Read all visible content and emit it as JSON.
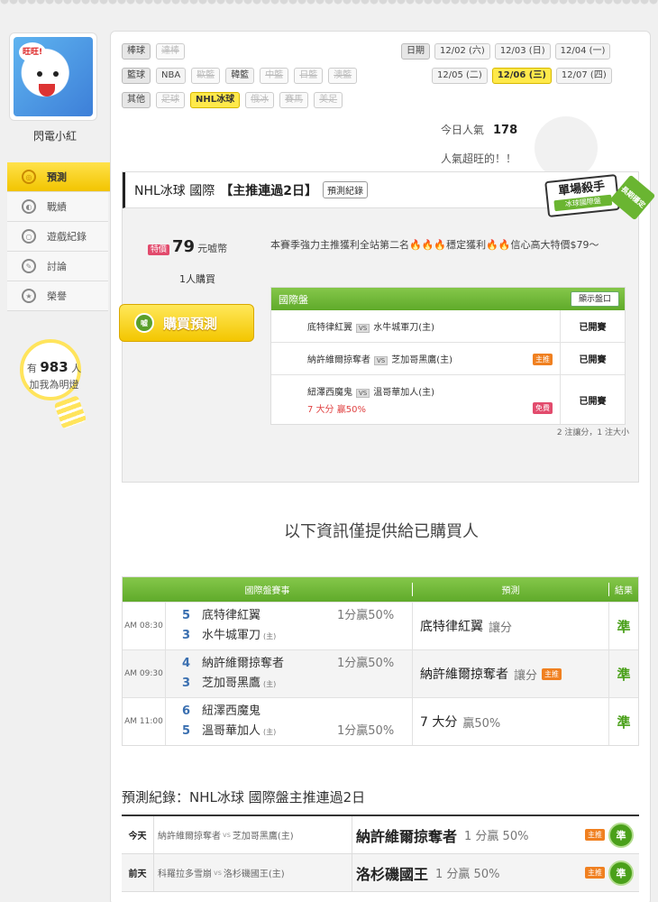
{
  "user": {
    "name": "閃電小紅",
    "avatar_bubble": "旺旺!"
  },
  "menu": [
    {
      "label": "預測",
      "icon": "target-icon",
      "active": true
    },
    {
      "label": "戰績",
      "icon": "chart-icon",
      "active": false
    },
    {
      "label": "遊戲紀錄",
      "icon": "record-icon",
      "active": false
    },
    {
      "label": "討論",
      "icon": "chat-icon",
      "active": false
    },
    {
      "label": "榮譽",
      "icon": "medal-icon",
      "active": false
    }
  ],
  "fans": {
    "prefix": "有",
    "count": "983",
    "suffix": "人",
    "cta": "加我為明燈"
  },
  "filters": {
    "baseball": {
      "label": "棒球",
      "items": [
        "達棒"
      ]
    },
    "basketball": {
      "label": "籃球",
      "items": [
        "NBA",
        "歐籃",
        "韓籃",
        "中籃",
        "日籃",
        "澳籃"
      ]
    },
    "other": {
      "label": "其他",
      "items": [
        "足球",
        "NHL冰球",
        "俄冰",
        "賽馬",
        "美足"
      ]
    }
  },
  "dates": {
    "label": "日期",
    "items": [
      "12/02 (六)",
      "12/03 (日)",
      "12/04 (一)",
      "12/05 (二)",
      "12/06 (三)",
      "12/07 (四)"
    ],
    "selected": "12/06 (三)"
  },
  "popularity": {
    "label": "今日人氣",
    "value": "178",
    "message": "人氣超旺的！！"
  },
  "product": {
    "title": "NHL冰球 國際",
    "bracket": "【主推連過2日】",
    "record_button": "預測紀錄",
    "badge_main": "單場殺手",
    "badge_sub": "冰球國際盤",
    "ribbon": "長期穩定",
    "price_tag": "特價",
    "price": "79",
    "price_unit": "元嘘幣",
    "buyers": "1人購買",
    "buy_button": "購買預測",
    "buy_coin": "嘘",
    "description": "本賽季強力主推獲利全站第二名🔥🔥🔥穩定獲利🔥🔥信心高大特價$79～",
    "intl_header": "國際盤",
    "show_button": "顯示盤口",
    "games": [
      {
        "away": "底特律紅翼",
        "home": "水牛城軍刀(主)",
        "status": "已開賽",
        "tag": "",
        "pick": ""
      },
      {
        "away": "納許維爾掠奪者",
        "home": "芝加哥黑鷹(主)",
        "status": "已開賽",
        "tag": "主推",
        "pick": ""
      },
      {
        "away": "紐澤西魔鬼",
        "home": "溫哥華加人(主)",
        "status": "已開賽",
        "tag": "免費",
        "pick": "7 大分 贏50%"
      }
    ],
    "vs_label": "VS",
    "note": "2 注讓分，1 注大小"
  },
  "info_message": "以下資訊僅提供給已購買人",
  "results": {
    "headers": {
      "match": "國際盤賽事",
      "prediction": "預測",
      "result": "結果"
    },
    "home_mark": "(主)",
    "rows": [
      {
        "time": "AM 08:30",
        "away_score": "5",
        "away": "底特律紅翼",
        "home_score": "3",
        "home": "水牛城軍刀",
        "odds": "1分贏50%",
        "odds_row": "top",
        "pick": "底特律紅翼",
        "pick_sub": "讓分",
        "tag": "",
        "result": "準"
      },
      {
        "time": "AM 09:30",
        "away_score": "4",
        "away": "納許維爾掠奪者",
        "home_score": "3",
        "home": "芝加哥黑鷹",
        "odds": "1分贏50%",
        "odds_row": "top",
        "pick": "納許維爾掠奪者",
        "pick_sub": "讓分",
        "tag": "主推",
        "result": "準"
      },
      {
        "time": "AM 11:00",
        "away_score": "6",
        "away": "紐澤西魔鬼",
        "home_score": "5",
        "home": "溫哥華加人",
        "odds": "1分贏50%",
        "odds_row": "bottom",
        "pick": "7 大分",
        "pick_sub": "贏50%",
        "tag": "",
        "result": "準"
      }
    ]
  },
  "history": {
    "title": "預測紀錄：NHL冰球 國際盤主推連過2日",
    "vs": "vs",
    "rows": [
      {
        "day": "今天",
        "away": "納許維爾掠奪者",
        "home": "芝加哥黑鷹(主)",
        "pick": "納許維爾掠奪者",
        "pick_sub": "1 分贏 50%",
        "tag": "主推",
        "result": "準"
      },
      {
        "day": "前天",
        "away": "科羅拉多雪崩",
        "home": "洛杉磯國王(主)",
        "pick": "洛杉磯國王",
        "pick_sub": "1 分贏 50%",
        "tag": "主推",
        "result": "準"
      }
    ]
  }
}
